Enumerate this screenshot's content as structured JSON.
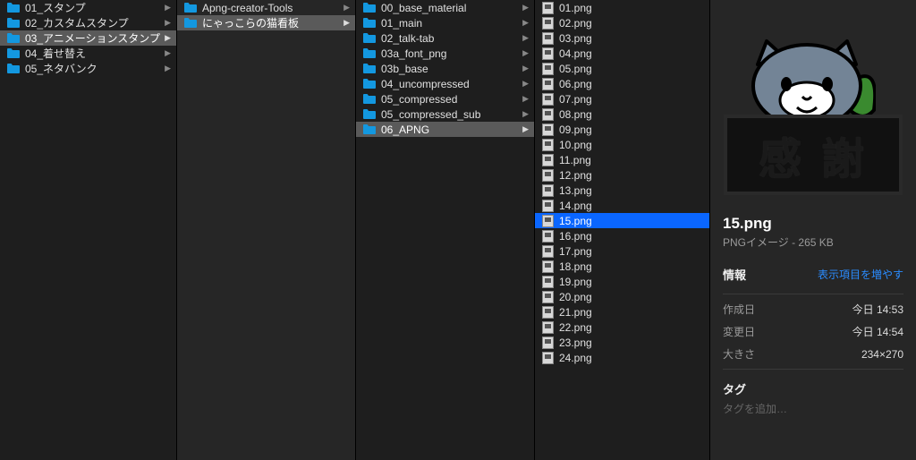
{
  "col1": {
    "items": [
      {
        "label": "01_スタンプ",
        "selected": false
      },
      {
        "label": "02_カスタムスタンプ",
        "selected": false
      },
      {
        "label": "03_アニメーションスタンプ",
        "selected": true
      },
      {
        "label": "04_着せ替え",
        "selected": false
      },
      {
        "label": "05_ネタバンク",
        "selected": false
      }
    ]
  },
  "col2": {
    "items": [
      {
        "label": "Apng-creator-Tools",
        "selected": false
      },
      {
        "label": "にゃっこらの猫看板",
        "selected": true
      }
    ]
  },
  "col3": {
    "items": [
      {
        "label": "00_base_material",
        "selected": false
      },
      {
        "label": "01_main",
        "selected": false
      },
      {
        "label": "02_talk-tab",
        "selected": false
      },
      {
        "label": "03a_font_png",
        "selected": false
      },
      {
        "label": "03b_base",
        "selected": false
      },
      {
        "label": "04_uncompressed",
        "selected": false
      },
      {
        "label": "05_compressed",
        "selected": false
      },
      {
        "label": "05_compressed_sub",
        "selected": false
      },
      {
        "label": "06_APNG",
        "selected": true
      }
    ]
  },
  "col4": {
    "items": [
      {
        "label": "01.png"
      },
      {
        "label": "02.png"
      },
      {
        "label": "03.png"
      },
      {
        "label": "04.png"
      },
      {
        "label": "05.png"
      },
      {
        "label": "06.png"
      },
      {
        "label": "07.png"
      },
      {
        "label": "08.png"
      },
      {
        "label": "09.png"
      },
      {
        "label": "10.png"
      },
      {
        "label": "11.png"
      },
      {
        "label": "12.png"
      },
      {
        "label": "13.png"
      },
      {
        "label": "14.png"
      },
      {
        "label": "15.png",
        "active": true
      },
      {
        "label": "16.png"
      },
      {
        "label": "17.png"
      },
      {
        "label": "18.png"
      },
      {
        "label": "19.png"
      },
      {
        "label": "20.png"
      },
      {
        "label": "21.png"
      },
      {
        "label": "22.png"
      },
      {
        "label": "23.png"
      },
      {
        "label": "24.png"
      }
    ]
  },
  "preview": {
    "sign_text_1": "感",
    "sign_text_2": "謝",
    "filename": "15.png",
    "subtitle": "PNGイメージ - 265 KB",
    "info_header_label": "情報",
    "info_header_link": "表示項目を増やす",
    "rows": [
      {
        "k": "作成日",
        "v": "今日 14:53"
      },
      {
        "k": "変更日",
        "v": "今日 14:54"
      },
      {
        "k": "大きさ",
        "v": "234×270"
      }
    ],
    "tags_title": "タグ",
    "tags_placeholder": "タグを追加…"
  },
  "colors": {
    "folder_blue": "#1398e0",
    "selection_dim": "#5a5a5a",
    "selection_active": "#0a66ff"
  }
}
